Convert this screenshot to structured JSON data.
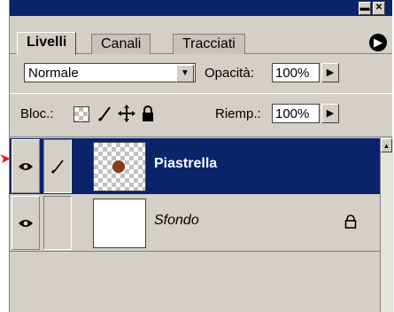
{
  "window": {
    "minimize_glyph": "▬",
    "close_glyph": "✕"
  },
  "tabs": [
    {
      "label": "Livelli",
      "active": true
    },
    {
      "label": "Canali",
      "active": false
    },
    {
      "label": "Tracciati",
      "active": false
    }
  ],
  "panel_menu_glyph": "▶",
  "blend": {
    "mode": "Normale",
    "opacity_label": "Opacità:",
    "opacity_value": "100%"
  },
  "lock": {
    "label": "Bloc.:",
    "fill_label": "Riemp.:",
    "fill_value": "100%"
  },
  "layers": [
    {
      "name": "Piastrella",
      "selected": true,
      "visible": true,
      "locked": false
    },
    {
      "name": "Sfondo",
      "selected": false,
      "visible": true,
      "locked": true
    }
  ],
  "icons": {
    "eye": "eye-icon",
    "brush": "brush-icon",
    "move": "move-icon",
    "lock": "lock-icon",
    "transparency": "checker-icon"
  },
  "colors": {
    "selected_layer_bg": "#0a246a",
    "panel_bg": "#d4d0c8",
    "pointer_arrow": "#e0201a"
  }
}
